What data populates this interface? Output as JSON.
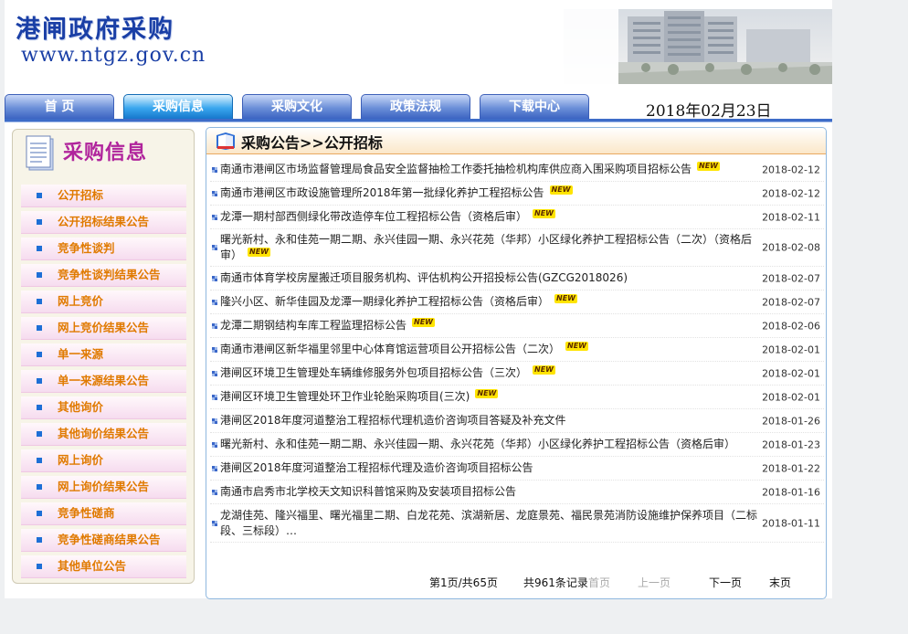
{
  "header": {
    "site_title": "港闸政府采购",
    "site_url": "www.ntgz.gov.cn"
  },
  "nav": {
    "tabs": [
      {
        "label": "首 页",
        "active": false
      },
      {
        "label": "采购信息",
        "active": true
      },
      {
        "label": "采购文化",
        "active": false
      },
      {
        "label": "政策法规",
        "active": false
      },
      {
        "label": "下载中心",
        "active": false
      }
    ],
    "date": "2018年02月23日"
  },
  "sidebar": {
    "title": "采购信息",
    "items": [
      "公开招标",
      "公开招标结果公告",
      "竞争性谈判",
      "竞争性谈判结果公告",
      "网上竞价",
      "网上竞价结果公告",
      "单一来源",
      "单一来源结果公告",
      "其他询价",
      "其他询价结果公告",
      "网上询价",
      "网上询价结果公告",
      "竞争性磋商",
      "竞争性磋商结果公告",
      "其他单位公告"
    ]
  },
  "main": {
    "title": "采购公告>>公开招标",
    "new_label": "NEW",
    "rows": [
      {
        "title": "南通市港闸区市场监督管理局食品安全监督抽检工作委托抽检机构库供应商入围采购项目招标公告",
        "date": "2018-02-12",
        "is_new": true
      },
      {
        "title": "南通市港闸区市政设施管理所2018年第一批绿化养护工程招标公告",
        "date": "2018-02-12",
        "is_new": true
      },
      {
        "title": "龙潭一期村部西侧绿化带改造停车位工程招标公告（资格后审）",
        "date": "2018-02-11",
        "is_new": true
      },
      {
        "title": "曙光新村、永和佳苑一期二期、永兴佳园一期、永兴花苑（华邦）小区绿化养护工程招标公告（二次）（资格后审）",
        "date": "2018-02-08",
        "is_new": true
      },
      {
        "title": "南通市体育学校房屋搬迁项目服务机构、评估机构公开招投标公告(GZCG2018026)",
        "date": "2018-02-07",
        "is_new": false
      },
      {
        "title": "隆兴小区、新华佳园及龙潭一期绿化养护工程招标公告（资格后审）",
        "date": "2018-02-07",
        "is_new": true
      },
      {
        "title": "龙潭二期钢结构车库工程监理招标公告",
        "date": "2018-02-06",
        "is_new": true
      },
      {
        "title": "南通市港闸区新华福里邻里中心体育馆运营项目公开招标公告（二次）",
        "date": "2018-02-01",
        "is_new": true
      },
      {
        "title": "港闸区环境卫生管理处车辆维修服务外包项目招标公告（三次）",
        "date": "2018-02-01",
        "is_new": true
      },
      {
        "title": "港闸区环境卫生管理处环卫作业轮胎采购项目(三次)",
        "date": "2018-02-01",
        "is_new": true
      },
      {
        "title": "港闸区2018年度河道整治工程招标代理机造价咨询项目答疑及补充文件",
        "date": "2018-01-26",
        "is_new": false
      },
      {
        "title": "曙光新村、永和佳苑一期二期、永兴佳园一期、永兴花苑（华邦）小区绿化养护工程招标公告（资格后审）",
        "date": "2018-01-23",
        "is_new": false
      },
      {
        "title": "港闸区2018年度河道整治工程招标代理及造价咨询项目招标公告",
        "date": "2018-01-22",
        "is_new": false
      },
      {
        "title": "南通市启秀市北学校天文知识科普馆采购及安装项目招标公告",
        "date": "2018-01-16",
        "is_new": false
      },
      {
        "title": "龙湖佳苑、隆兴福里、曙光福里二期、白龙花苑、滨湖新居、龙庭景苑、福民景苑消防设施维护保养项目（二标段、三标段）…",
        "date": "2018-01-11",
        "is_new": false
      }
    ]
  },
  "pager": {
    "page_info": "第1页/共65页",
    "total_info": "共961条记录",
    "first": "首页",
    "prev": "上一页",
    "next": "下一页",
    "last": "末页"
  }
}
